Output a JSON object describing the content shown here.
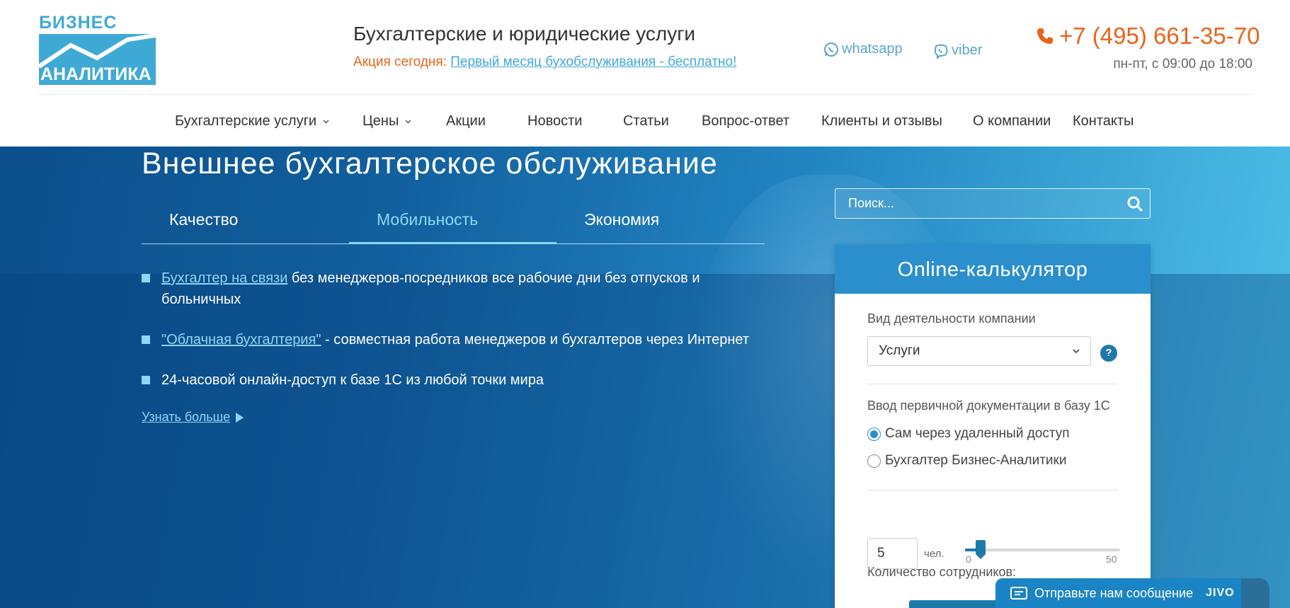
{
  "logo": {
    "top": "БИЗНЕС",
    "bottom": "АНАЛИТИКА"
  },
  "header": {
    "tagline": "Бухгалтерские и юридические услуги",
    "promo_label": "Акция сегодня:",
    "promo_link": "Первый месяц бухобслуживания - бесплатно!",
    "whatsapp": "whatsapp",
    "viber": "viber",
    "phone": "+7 (495) 661-35-70",
    "hours": "пн-пт, с 09:00 до 18:00"
  },
  "nav": {
    "items": [
      {
        "label": "Бухгалтерские услуги",
        "dropdown": true
      },
      {
        "label": "Цены",
        "dropdown": true
      },
      {
        "label": "Акции"
      },
      {
        "label": "Новости"
      },
      {
        "label": "Статьи"
      },
      {
        "label": "Вопрос-ответ"
      },
      {
        "label": "Клиенты и отзывы"
      },
      {
        "label": "О компании"
      },
      {
        "label": "Контакты"
      }
    ]
  },
  "hero": {
    "title": "Внешнее бухгалтерское обслуживание",
    "tabs": [
      {
        "label": "Качество",
        "active": false
      },
      {
        "label": "Мобильность",
        "active": true
      },
      {
        "label": "Экономия",
        "active": false
      }
    ],
    "bullets": [
      {
        "link": "Бухгалтер на связи",
        "text": " без менеджеров-посредников все рабочие дни без отпусков и больничных"
      },
      {
        "link": "\"Облачная бухгалтерия\"",
        "text": " - совместная работа менеджеров и бухгалтеров через Интернет"
      },
      {
        "link": "",
        "text": "24-часовой онлайн-доступ к базе 1С из любой точки мира"
      }
    ],
    "more": "Узнать больше"
  },
  "search": {
    "placeholder": "Поиск..."
  },
  "calculator": {
    "title": "Online-калькулятор",
    "activity_label": "Вид деятельности компании",
    "activity_value": "Услуги",
    "help": "?",
    "docs_label": "Ввод первичной документации в базу 1С",
    "docs_options": [
      {
        "label": "Сам через удаленный доступ",
        "checked": true
      },
      {
        "label": "Бухгалтер Бизнес-Аналитики",
        "checked": false
      }
    ],
    "employees_label": "Количество сотрудников:",
    "employees_value": "5",
    "employees_unit": "чел.",
    "slider_min": "0",
    "slider_max": "50",
    "slider_value": 5
  },
  "chat": {
    "text": "Отправьте нам сообщение",
    "brand": "JIVO"
  },
  "colors": {
    "accent": "#e8641b",
    "brand": "#3fa9d6",
    "hero": "#12609f",
    "calc_header": "#2b8fcd"
  }
}
